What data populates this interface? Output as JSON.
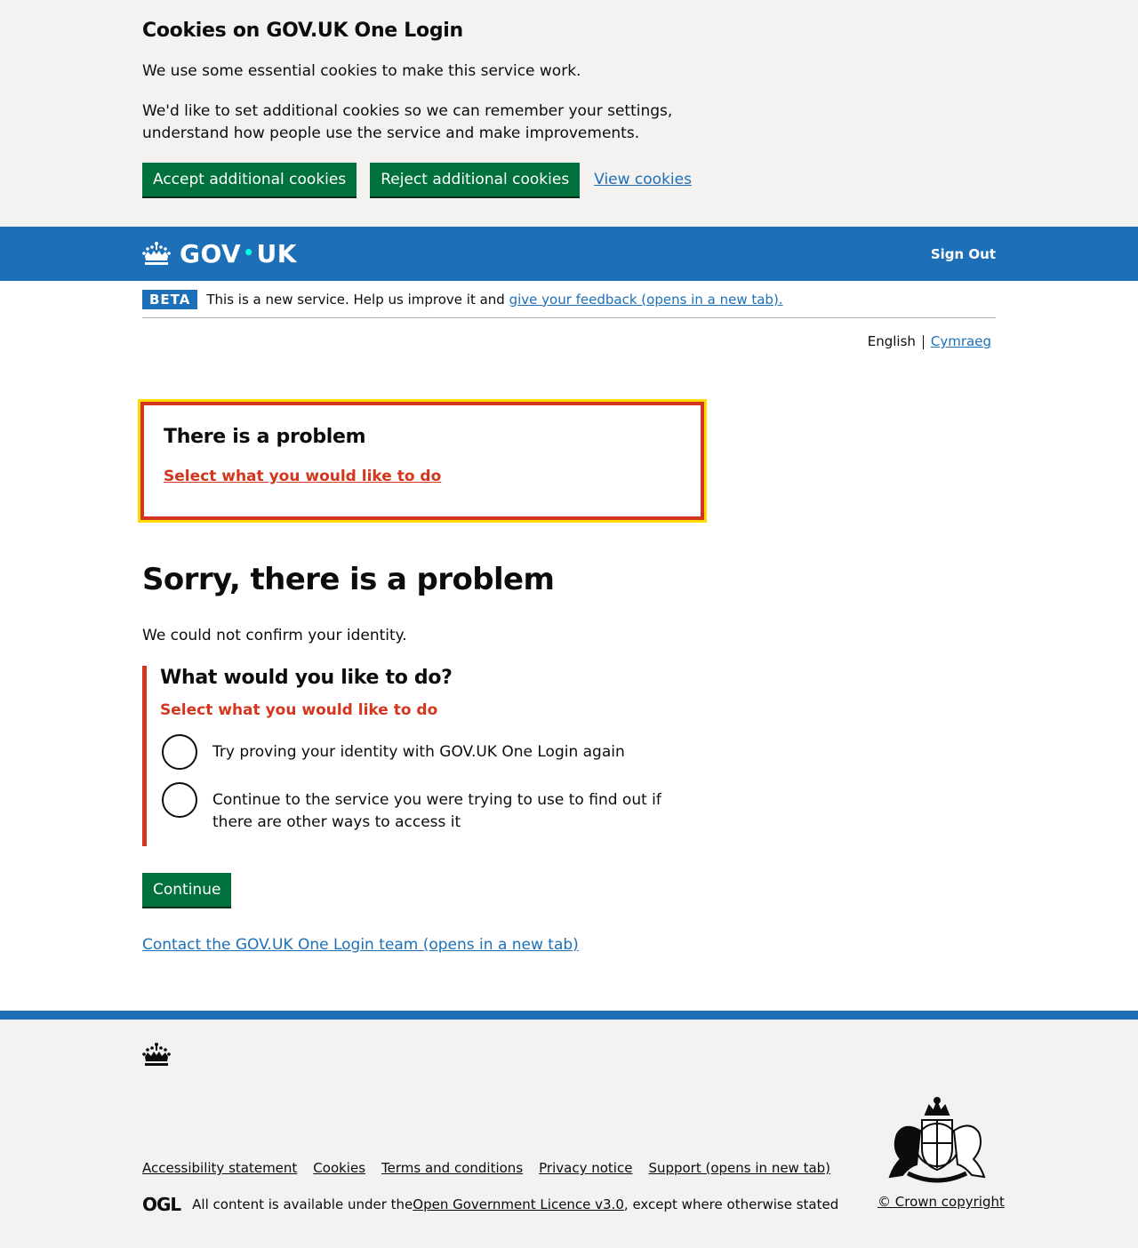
{
  "cookie_banner": {
    "title": "Cookies on GOV.UK One Login",
    "para1": "We use some essential cookies to make this service work.",
    "para2": "We'd like to set additional cookies so we can remember your settings, understand how people use the service and make improvements.",
    "accept_label": "Accept additional cookies",
    "reject_label": "Reject additional cookies",
    "view_label": "View cookies"
  },
  "header": {
    "logo_gov": "GOV",
    "logo_dot": "•",
    "logo_uk": "UK",
    "sign_out": "Sign Out"
  },
  "phase_banner": {
    "tag": "BETA",
    "text": "This is a new service. Help us improve it and ",
    "link": "give your feedback (opens in a new tab)."
  },
  "language": {
    "current": "English",
    "other": "Cymraeg"
  },
  "error_summary": {
    "title": "There is a problem",
    "link": "Select what you would like to do"
  },
  "main": {
    "heading": "Sorry, there is a problem",
    "lead": "We could not confirm your identity.",
    "question": "What would you like to do?",
    "field_error": "Select what you would like to do",
    "options": [
      "Try proving your identity with GOV.UK One Login again",
      "Continue to the service you were trying to use to find out if there are other ways to access it"
    ],
    "continue_label": "Continue",
    "contact_link": "Contact the GOV.UK One Login team (opens in a new tab)"
  },
  "footer": {
    "links": [
      "Accessibility statement",
      "Cookies",
      "Terms and conditions",
      "Privacy notice",
      "Support (opens in new tab)"
    ],
    "ogl_logo": "OGL",
    "licence_pre": "All content is available under the ",
    "licence_link": "Open Government Licence v3.0",
    "licence_post": ", except where otherwise stated",
    "copyright": "© Crown copyright"
  },
  "colors": {
    "brand_blue": "#1d70b8",
    "button_green": "#00703c",
    "error_red": "#d4351c",
    "focus_yellow": "#ffdd00",
    "banner_grey": "#f3f2f1"
  }
}
